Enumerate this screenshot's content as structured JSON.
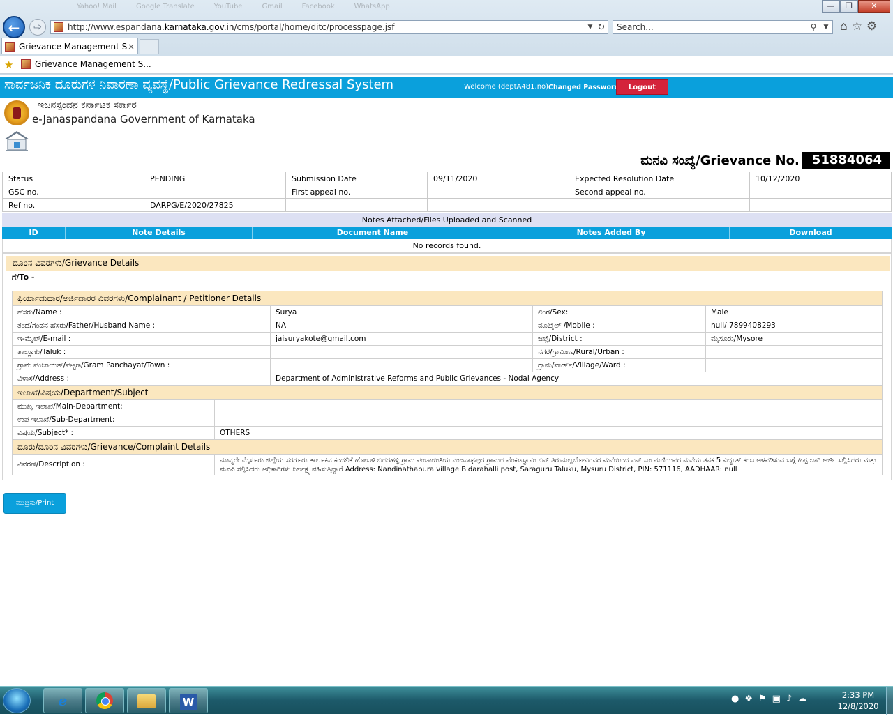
{
  "browser": {
    "background_tabs": [
      "Yahoo! Mail",
      "Google Translate",
      "YouTube",
      "Gmail",
      "Facebook",
      "WhatsApp"
    ],
    "url_prefix": "http://www.espandana.",
    "url_domain": "karnataka.gov.in",
    "url_suffix": "/cms/portal/home/ditc/processpage.jsf",
    "search_placeholder": "Search...",
    "tab_title": "Grievance Management Sys...",
    "tab_close": "×",
    "favorite_label": "Grievance Management S...",
    "window_min": "—",
    "window_max": "❐",
    "window_close": "✕",
    "back_glyph": "←",
    "fwd_glyph": "⇨"
  },
  "header": {
    "title": "ಸಾರ್ವಜನಿಕ ದೂರುಗಳ ನಿವಾರಣಾ ವ್ಯವಸ್ಥೆ/Public Grievance Redressal System",
    "welcome": "Welcome (deptA481.no)",
    "changed_password": "Changed Password",
    "logout": "Logout"
  },
  "brand": {
    "kannada": "ಇಜನಸ್ಪಂದನ ಕರ್ನಾಟಕ ಸರ್ಕಾರ",
    "english": "e-Janaspandana Government of Karnataka"
  },
  "grievance": {
    "label": "ಮನವಿ ಸಂಖ್ಯೆ/Grievance No.",
    "number": "51884064"
  },
  "status_table": {
    "status_label": "Status",
    "status_value": "PENDING",
    "submission_label": "Submission Date",
    "submission_value": "09/11/2020",
    "expected_label": "Expected Resolution Date",
    "expected_value": "10/12/2020",
    "gsc_label": "GSC no.",
    "gsc_value": "",
    "first_appeal_label": "First appeal no.",
    "first_appeal_value": "",
    "second_appeal_label": "Second appeal no.",
    "second_appeal_value": "",
    "ref_label": "Ref no.",
    "ref_value": "DARPG/E/2020/27825"
  },
  "notes": {
    "caption": "Notes Attached/Files Uploaded and Scanned",
    "columns": [
      "ID",
      "Note Details",
      "Document Name",
      "Notes Added By",
      "Download"
    ],
    "empty": "No records found."
  },
  "details": {
    "header": "ದೂರಿನ ವಿವರಗಳು/Grievance Details",
    "to_label": "ಗೆ/To -",
    "complainant_header": "ಫಿರ್ಯಾದುದಾರ/ಅರ್ಜಿದಾರರ ವಿವರಗಳು/Complainant / Petitioner Details",
    "name_label": "ಹೆಸರು/Name :",
    "name_value": "Surya",
    "sex_label": "ಲಿಂಗ/Sex:",
    "sex_value": "Male",
    "father_label": "ತಂದೆ/ಗಂಡನ ಹೆಸರು/Father/Husband Name :",
    "father_value": "NA",
    "mobile_label": "ಮೊಬೈಲ್ /Mobile :",
    "mobile_value": "null/ 7899408293",
    "email_label": "ಇ-ಮೈಲ್/E-mail :",
    "email_value": "jaisuryakote@gmail.com",
    "district_label": "ಜಿಲ್ಲೆ/District :",
    "district_value": "ಮೈಸೂರು/Mysore",
    "taluk_label": "ತಾಲ್ಲೂಕು/Taluk :",
    "taluk_value": "",
    "rural_label": "ನಗರ/ಗ್ರಾಮೀಣ/Rural/Urban :",
    "rural_value": "",
    "gp_label": "ಗ್ರಾಮ ಪಂಚಾಯತ್/ಪಟ್ಟಣ/Gram Panchayat/Town :",
    "gp_value": "",
    "village_label": "ಗ್ರಾಮ/ವಾರ್ಡ್/Village/Ward :",
    "village_value": "",
    "address_label": "ವಿಳಾಸ/Address :",
    "address_value": "Department of Administrative Reforms and Public Grievances - Nodal Agency",
    "dept_header": "ಇಲಾಖೆ/ವಿಷಯ/Department/Subject",
    "main_dept_label": "ಮುಖ್ಯ ಇಲಾಖೆ/Main-Department:",
    "main_dept_value": "",
    "sub_dept_label": "ಉಪ ಇಲಾಖೆ/Sub-Department:",
    "sub_dept_value": "",
    "subject_label": "ವಿಷಯ/Subject* :",
    "subject_value": "OTHERS",
    "complaint_header": "ದೂರು/ದೂರಿನ ವಿವರಗಳು/Grievance/Complaint Details",
    "description_label": "ವಿವರಣೆ/Description :",
    "description_value": "ಮಾನ್ಯರೇ ಮೈಸೂರು ಜಿಲ್ಲೆಯ ಸರಗೂರು ತಾಲೂಕಿನ ಕಂದಲಿಕೆ ಹೋಬಳಿ ಬಿದರಹಳ್ಳಿ ಗ್ರಾಮ ಪಂಚಾಯಿತಿಯ ನಂಜನಾಥಪುರ ಗ್ರಾಮದ ವೆಂಕಟಸ್ವಾಮಿ ಬಿನ್ ತಿರುಮಲ್ಲಬೋವಿರವರ ಮನೆಯಿಂದ ಎನ್ ಎಂ ಮಣಿಯವರ ಮನೆಯ ತನಕ 5 ವಿದ್ಯುತ್ ಕಂಬ ಅಳವಡಿಸುವ ಬಗ್ಗೆ ಹಿಪ್ಪ ಬಾರಿ ಅರ್ಜಿ ಸಲ್ಲಿಸಿದರು ಮತ್ತು ಮನವಿ ಸಲ್ಲಿಸಿದರು ಅಧಿಕಾರಿಗಳು ನಿರ್ಲಕ್ಷ್ಯ ವಹಿಸುತ್ತಿದ್ದಾರೆ Address: Nandinathapura village Bidarahalli post, Saraguru Taluku, Mysuru District, PIN: 571116, AADHAAR: null"
  },
  "print_label": "ಮುದ್ರಿಸು/Print",
  "taskbar": {
    "time": "2:33 PM",
    "date": "12/8/2020",
    "word_letter": "W",
    "ie_letter": "e"
  }
}
